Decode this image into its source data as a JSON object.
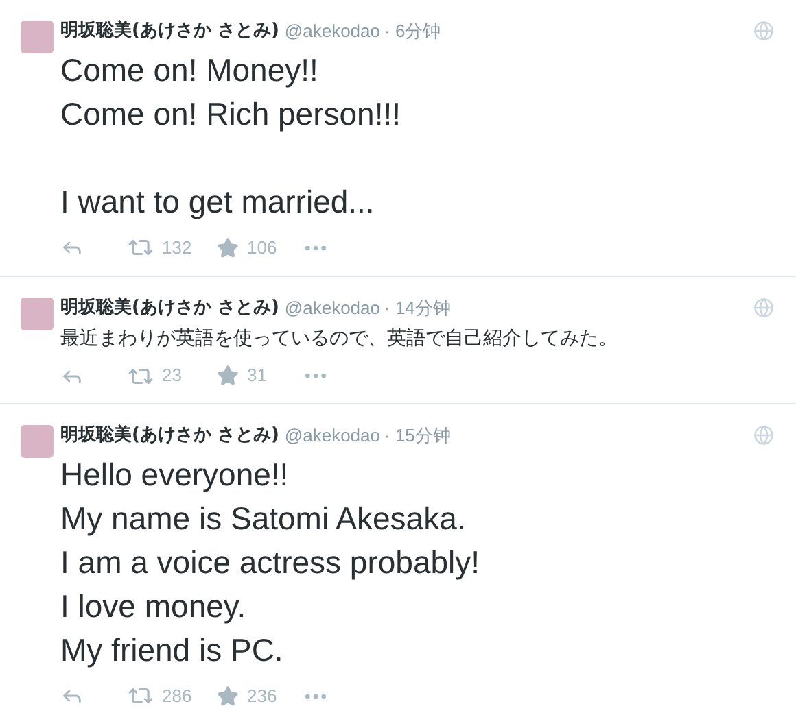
{
  "tweets": [
    {
      "name": "明坂聡美(あけさか さとみ)",
      "handle": "@akekodao",
      "time": "· 6分钟",
      "kind": "large",
      "text": "Come on! Money!!\nCome on! Rich person!!!\n\nI want to get married...",
      "retweets": "132",
      "favorites": "106"
    },
    {
      "name": "明坂聡美(あけさか さとみ)",
      "handle": "@akekodao",
      "time": "· 14分钟",
      "kind": "normal",
      "text": "最近まわりが英語を使っているので、英語で自己紹介してみた。",
      "retweets": "23",
      "favorites": "31"
    },
    {
      "name": "明坂聡美(あけさか さとみ)",
      "handle": "@akekodao",
      "time": "· 15分钟",
      "kind": "large",
      "text": "Hello everyone!!\nMy name is Satomi Akesaka.\nI am a voice actress probably!\nI love money.\nMy friend is PC.",
      "retweets": "286",
      "favorites": "236"
    }
  ]
}
